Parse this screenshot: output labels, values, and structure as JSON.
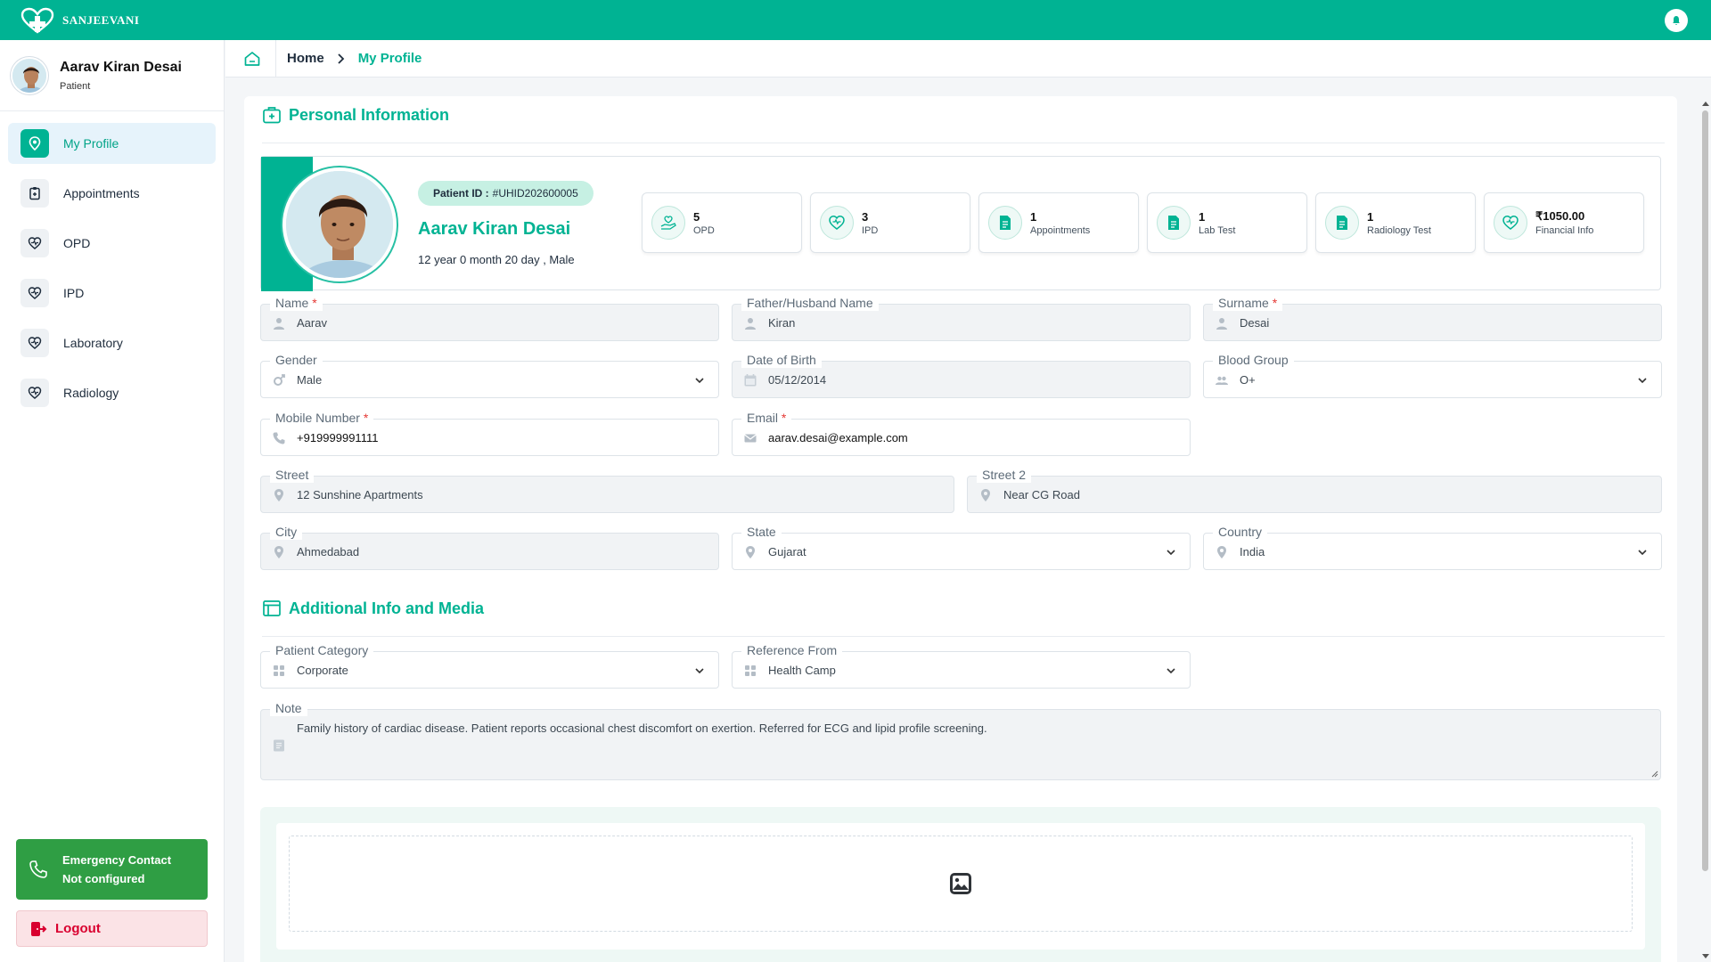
{
  "app": {
    "name": "Sanjeevani"
  },
  "user": {
    "name": "Aarav Kiran Desai",
    "role": "Patient"
  },
  "nav": [
    {
      "label": "My Profile",
      "icon": "profile-pin-icon",
      "active": true
    },
    {
      "label": "Appointments",
      "icon": "clipboard-icon",
      "active": false
    },
    {
      "label": "OPD",
      "icon": "heart-icon",
      "active": false
    },
    {
      "label": "IPD",
      "icon": "heart-icon",
      "active": false
    },
    {
      "label": "Laboratory",
      "icon": "heart-icon",
      "active": false
    },
    {
      "label": "Radiology",
      "icon": "heart-icon",
      "active": false
    }
  ],
  "emergency": {
    "title": "Emergency Contact",
    "status": "Not configured"
  },
  "logout": {
    "label": "Logout"
  },
  "breadcrumb": {
    "home": "Home",
    "current": "My Profile"
  },
  "sections": {
    "personal": "Personal Information",
    "additional": "Additional Info and Media"
  },
  "patient": {
    "id_label": "Patient ID :",
    "id_value": "#UHID202600005",
    "name": "Aarav Kiran Desai",
    "age_gender": "12 year 0 month 20 day , Male"
  },
  "stats": [
    {
      "value": "5",
      "label": "OPD",
      "icon": "hand-heart-icon"
    },
    {
      "value": "3",
      "label": "IPD",
      "icon": "heart-icon"
    },
    {
      "value": "1",
      "label": "Appointments",
      "icon": "document-icon"
    },
    {
      "value": "1",
      "label": "Lab Test",
      "icon": "document-icon"
    },
    {
      "value": "1",
      "label": "Radiology Test",
      "icon": "document-icon"
    },
    {
      "value": "₹1050.00",
      "label": "Financial Info",
      "icon": "heart-icon"
    }
  ],
  "form": {
    "name": {
      "label": "Name",
      "value": "Aarav"
    },
    "father": {
      "label": "Father/Husband Name",
      "value": "Kiran"
    },
    "surname": {
      "label": "Surname",
      "value": "Desai"
    },
    "gender": {
      "label": "Gender",
      "value": "Male"
    },
    "dob": {
      "label": "Date of Birth",
      "value": "05/12/2014"
    },
    "blood": {
      "label": "Blood Group",
      "value": "O+"
    },
    "mobile": {
      "label": "Mobile Number",
      "value": "+919999991111"
    },
    "email": {
      "label": "Email",
      "value": "aarav.desai@example.com"
    },
    "street": {
      "label": "Street",
      "value": "12 Sunshine Apartments"
    },
    "street2": {
      "label": "Street 2",
      "value": "Near CG Road"
    },
    "city": {
      "label": "City",
      "value": "Ahmedabad"
    },
    "state": {
      "label": "State",
      "value": "Gujarat"
    },
    "country": {
      "label": "Country",
      "value": "India"
    },
    "category": {
      "label": "Patient Category",
      "value": "Corporate"
    },
    "reference": {
      "label": "Reference From",
      "value": "Health Camp"
    },
    "note": {
      "label": "Note",
      "value": "Family history of cardiac disease. Patient reports occasional chest discomfort on exertion. Referred for ECG and lipid profile screening."
    }
  },
  "colors": {
    "accent": "#00b393",
    "danger": "#d9002f",
    "success": "#2f9e44"
  }
}
